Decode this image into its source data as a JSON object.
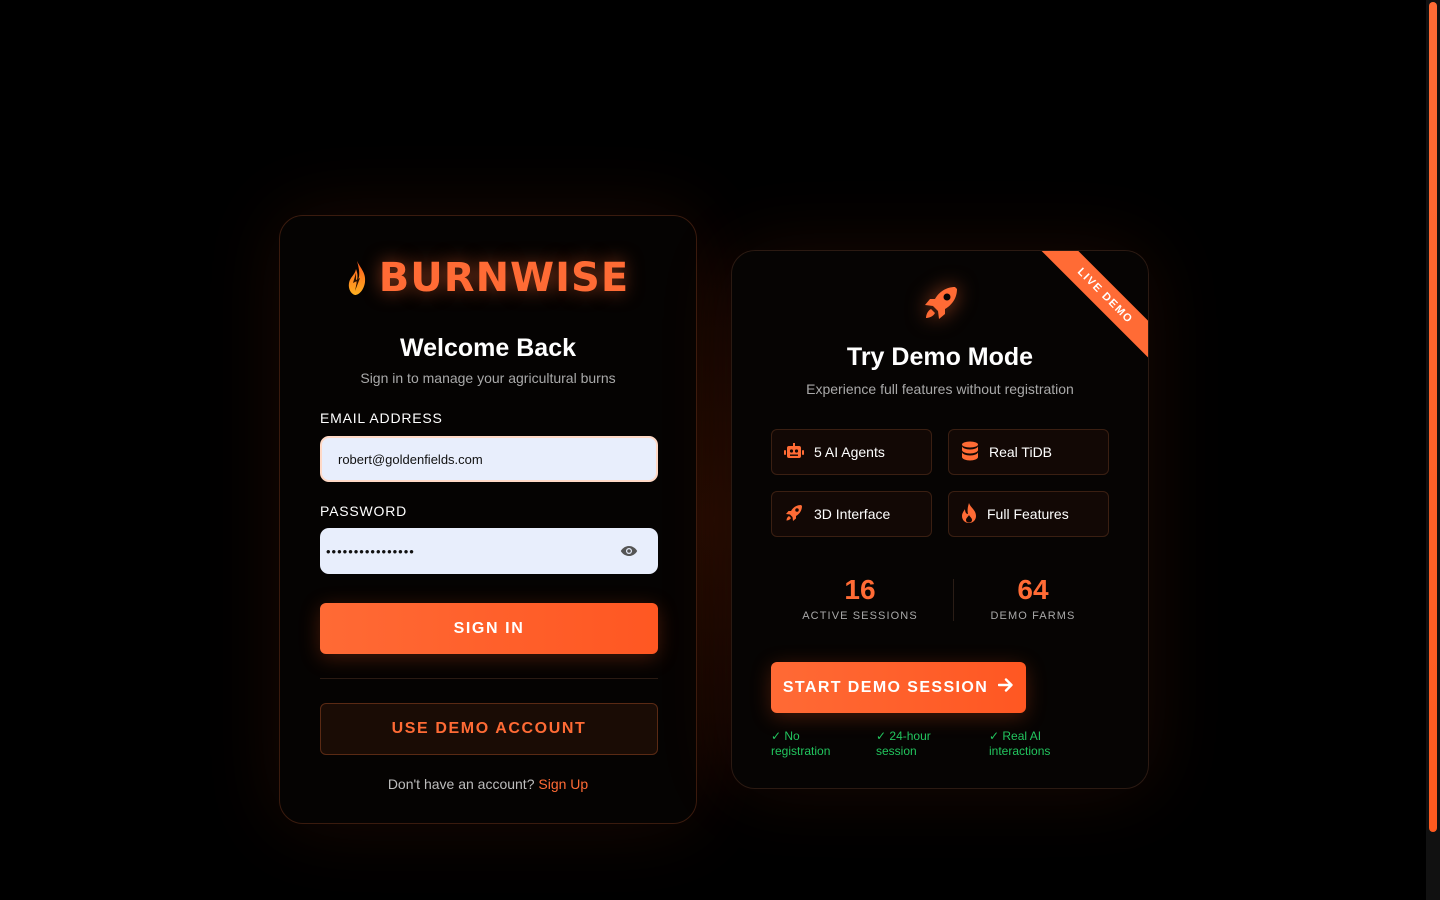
{
  "brand": {
    "name": "BURNWISE",
    "accent": "#ff6b35",
    "success": "#22c55e"
  },
  "login": {
    "title": "Welcome Back",
    "subtitle": "Sign in to manage your agricultural burns",
    "email_label": "EMAIL ADDRESS",
    "email_value": "robert@goldenfields.com",
    "password_label": "PASSWORD",
    "password_value": "••••••••••••••••",
    "sign_in_label": "SIGN IN",
    "demo_account_label": "USE DEMO ACCOUNT",
    "signup_prompt": "Don't have an account?",
    "signup_link": "Sign Up"
  },
  "demo": {
    "ribbon": "LIVE DEMO",
    "title": "Try Demo Mode",
    "subtitle": "Experience full features without registration",
    "features": [
      {
        "label": "5 AI Agents",
        "icon": "robot-icon"
      },
      {
        "label": "Real TiDB",
        "icon": "database-icon"
      },
      {
        "label": "3D Interface",
        "icon": "rocket-icon"
      },
      {
        "label": "Full Features",
        "icon": "fire-icon"
      }
    ],
    "stats": [
      {
        "value": "16",
        "label": "ACTIVE SESSIONS"
      },
      {
        "value": "64",
        "label": "DEMO FARMS"
      }
    ],
    "start_label": "START DEMO SESSION",
    "perks": [
      {
        "line1": "✓ No",
        "line2": "registration"
      },
      {
        "line1": "✓ 24-hour",
        "line2": "session"
      },
      {
        "line1": "✓ Real AI",
        "line2": "interactions"
      }
    ]
  }
}
